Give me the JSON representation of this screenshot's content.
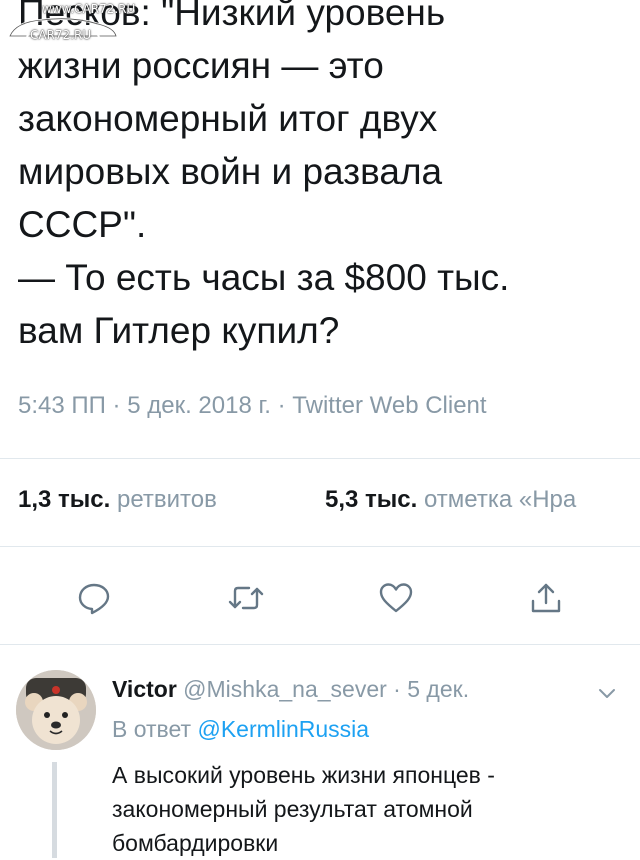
{
  "watermark": {
    "top": "www.CAR72.RU",
    "bottom": "CAR72.RU"
  },
  "tweet": {
    "lines": [
      "Песков: \"Низкий уровень",
      "жизни россиян — это",
      "закономерный итог двух",
      "мировых войн и развала",
      "СССР\".",
      "— То есть часы за $800 тыс.",
      "вам Гитлер купил?"
    ],
    "meta": "5:43 ПП · 5 дек. 2018 г. · Twitter Web Client",
    "retweets_count": "1,3 тыс.",
    "retweets_label": "ретвитов",
    "likes_count": "5,3 тыс.",
    "likes_label": "отметка «Нра"
  },
  "actions": {
    "icons": [
      "reply-icon",
      "retweet-icon",
      "like-icon",
      "share-icon"
    ],
    "color": "#657786"
  },
  "reply": {
    "name": "Victor",
    "handle": "@Mishka_na_sever",
    "dot": "·",
    "date": "5 дек.",
    "reply_prefix": "В ответ",
    "reply_mention": "@KermlinRussia",
    "lines": [
      "А высокий уровень жизни японцев -",
      "закономерный результат атомной",
      "бомбардировки"
    ]
  },
  "colors": {
    "text": "#14171a",
    "muted": "#8899a6",
    "link": "#1da1f2",
    "divider": "#e1e8ed"
  }
}
